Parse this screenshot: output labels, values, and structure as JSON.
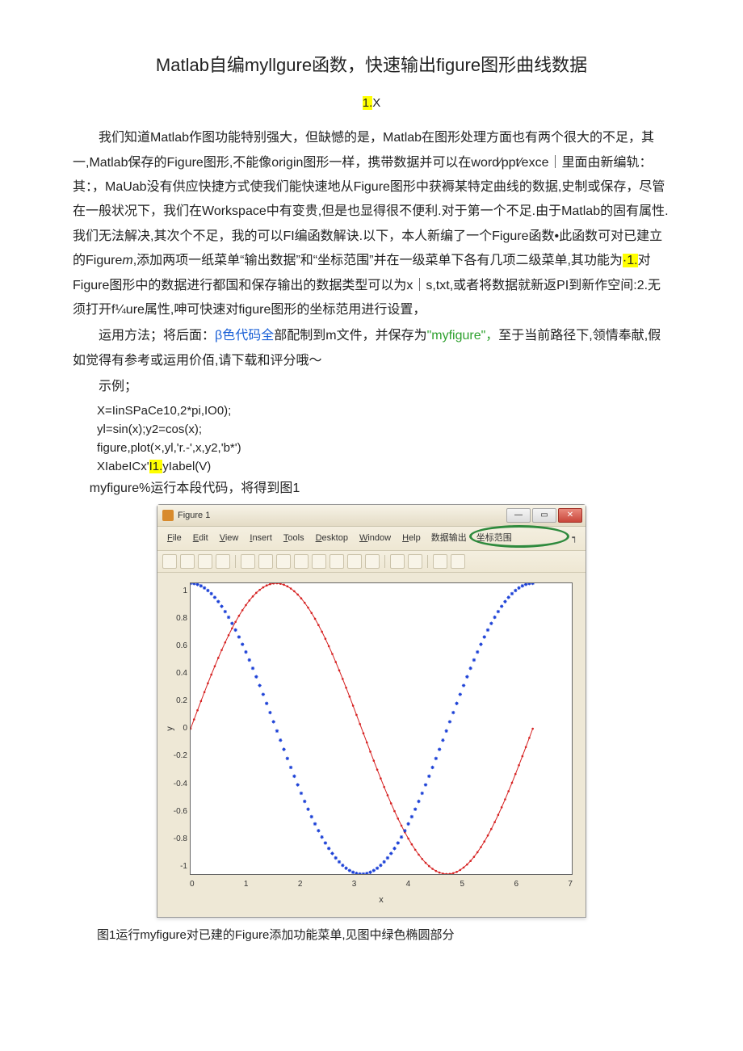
{
  "title": "Matlab自编myllgure函数，快速输出figure图形曲线数据",
  "subheading_prefix": "1.",
  "subheading_suffix": "X",
  "para1": "我们知道Matlab作图功能特别强大，但缺憾的是，Matlab在图形处理方面也有两个很大的不足，其一,Matlab保存的Figure图形,不能像origin图形一样，携带数据并可以在word∕ppt∕exce｜里面由新编轨：其：，MaUab没有供应快捷方式使我们能快速地从Figure图形中获褥某特定曲线的数据,史制或保存，尽管在一般状况下，我们在Workspace中有变贵,但是也显得很不便利.对于第一个不足.由于Matlab的固有属性.我们无法解决,其次个不足，我的可以FI编函数解诀.以下，本人新编了一个Figure函数•此函数可对已建立的Figure",
  "para1_m": "m",
  "para1_cont": ",添加两项一纸菜单“输出数据”和“坐标范围”并在一级菜单下各有几项二级菜单,其功能为",
  "para1_hl": "·1.",
  "para1_end": "对Figure图形中的数据进行都国和保存输出的数据类型可以为x｜s,txt,或者将数据就新返PI到新作空间:2.无须打开f¼ure属性,呻可快速对figure图形的坐标范用进行设置，",
  "para2_a": "运用方法；将后面：",
  "para2_blue": "β色代码全",
  "para2_b": "部配制到m文件，并保存为",
  "para2_quote": "\"myfigure\"，",
  "para2_c": "至于当前路径下,领情奉献,假如觉得有参考或运用价佰,请下载和评分哦〜",
  "example_label": "示例；",
  "code1": "X=IinSPaCe10,2*pi,IO0);",
  "code2": "yl=sin(x);y2=cos(x);",
  "code3": "figure,plot(×,yl,'r.-',x,y2,'b*')",
  "code4_a": "XIabeICx'",
  "code4_hl": "I1.",
  "code4_b": "yIabel(V)",
  "run_line": "myfigure%运行本段代码，将得到图1",
  "figure_window": {
    "title": "Figure 1",
    "menus": [
      "File",
      "Edit",
      "View",
      "Insert",
      "Tools",
      "Desktop",
      "Window",
      "Help"
    ],
    "menus_cn": [
      "数据输出",
      "坐标范围"
    ],
    "ylabel": "y",
    "xlabel": "x",
    "yticks": [
      "1",
      "0.8",
      "0.6",
      "0.4",
      "0.2",
      "0",
      "-0.2",
      "-0.4",
      "-0.6",
      "-0.8",
      "-1"
    ],
    "xticks": [
      "0",
      "1",
      "2",
      "3",
      "4",
      "5",
      "6",
      "7"
    ]
  },
  "chart_data": {
    "type": "line",
    "xlim": [
      0,
      7
    ],
    "ylim": [
      -1,
      1
    ],
    "xlabel": "x",
    "ylabel": "y",
    "xticks": [
      0,
      1,
      2,
      3,
      4,
      5,
      6,
      7
    ],
    "yticks": [
      -1,
      -0.8,
      -0.6,
      -0.4,
      -0.2,
      0,
      0.2,
      0.4,
      0.6,
      0.8,
      1
    ],
    "series": [
      {
        "name": "sin(x)",
        "style": "r.-",
        "color": "#d62222",
        "x": [
          0,
          0.25,
          0.5,
          0.75,
          1,
          1.25,
          1.5,
          1.75,
          2,
          2.25,
          2.5,
          2.75,
          3,
          3.14,
          3.5,
          3.75,
          4,
          4.25,
          4.5,
          4.71,
          5,
          5.25,
          5.5,
          5.75,
          6,
          6.28
        ],
        "y": [
          0,
          0.247,
          0.479,
          0.682,
          0.841,
          0.949,
          0.997,
          0.984,
          0.909,
          0.778,
          0.599,
          0.382,
          0.141,
          0,
          -0.351,
          -0.572,
          -0.757,
          -0.895,
          -0.978,
          -1,
          -0.959,
          -0.859,
          -0.706,
          -0.508,
          -0.279,
          0
        ]
      },
      {
        "name": "cos(x)",
        "style": "b*",
        "color": "#1a3fd6",
        "x": [
          0,
          0.25,
          0.5,
          0.75,
          1,
          1.25,
          1.5,
          1.57,
          1.75,
          2,
          2.25,
          2.5,
          2.75,
          3,
          3.14,
          3.5,
          3.75,
          4,
          4.25,
          4.5,
          4.71,
          5,
          5.25,
          5.5,
          5.75,
          6,
          6.28
        ],
        "y": [
          1,
          0.969,
          0.878,
          0.732,
          0.54,
          0.315,
          0.071,
          0,
          -0.178,
          -0.416,
          -0.628,
          -0.801,
          -0.924,
          -0.99,
          -1,
          -0.936,
          -0.821,
          -0.654,
          -0.446,
          -0.211,
          0,
          0.284,
          0.512,
          0.709,
          0.862,
          0.96,
          1
        ]
      }
    ]
  },
  "caption": "图1运行myfigure对已建的Figure添加功能菜单,见图中绿色椭圆部分"
}
